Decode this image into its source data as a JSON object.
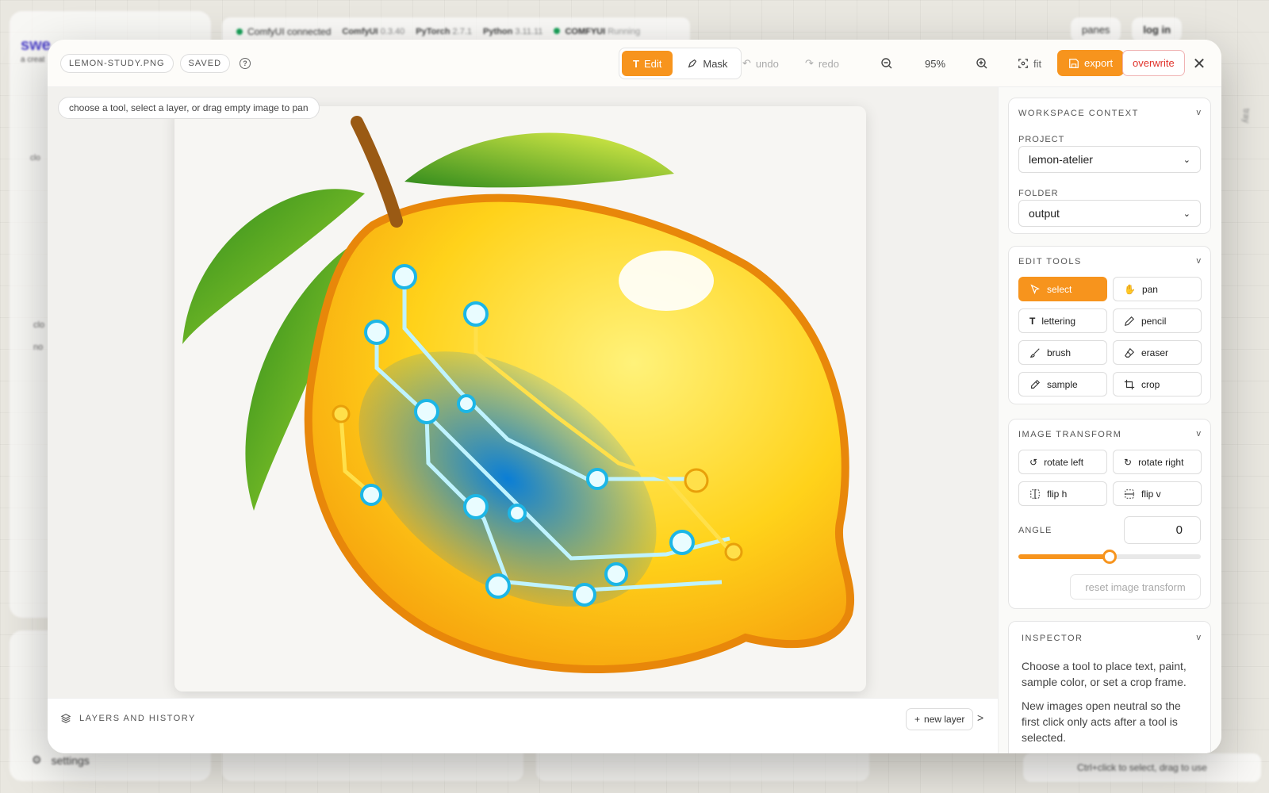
{
  "background": {
    "connection_status": "ComfyUI connected",
    "versions": [
      {
        "name": "ComfyUI",
        "value": "0.3.40"
      },
      {
        "name": "PyTorch",
        "value": "2.7.1"
      },
      {
        "name": "Python",
        "value": "3.11.11"
      }
    ],
    "server_name": "COMFYUI",
    "server_status": "Running",
    "brand": "swe",
    "brand_sub": "a creat",
    "panes_label": "panes",
    "login_label": "log in",
    "settings_label": "settings",
    "bottom_hint": "Ctrl+click to select, drag to use",
    "sidebar_labels": [
      "clo",
      "no"
    ],
    "tray_label": "tray"
  },
  "header": {
    "filename": "LEMON-STUDY.PNG",
    "save_status": "SAVED",
    "modes": [
      {
        "label": "Edit",
        "active": true
      },
      {
        "label": "Mask",
        "active": false
      }
    ],
    "undo_label": "undo",
    "redo_label": "redo",
    "zoom_level": "95%",
    "fit_label": "fit",
    "export_label": "export",
    "overwrite_label": "overwrite"
  },
  "canvas": {
    "hint": "choose a tool, select a layer, or drag empty image to pan"
  },
  "layers": {
    "title": "LAYERS AND HISTORY",
    "new_layer_label": "new layer",
    "expand_label": ">"
  },
  "sidebar": {
    "workspace": {
      "title": "WORKSPACE CONTEXT",
      "chevron": "v",
      "project_label": "PROJECT",
      "project_value": "lemon-atelier",
      "folder_label": "FOLDER",
      "folder_value": "output"
    },
    "edit_tools": {
      "title": "EDIT TOOLS",
      "chevron": "v",
      "tools": [
        {
          "label": "select",
          "icon": "cursor-icon",
          "active": true
        },
        {
          "label": "pan",
          "icon": "hand-icon",
          "active": false
        },
        {
          "label": "lettering",
          "icon": "text-icon",
          "active": false
        },
        {
          "label": "pencil",
          "icon": "pencil-icon",
          "active": false
        },
        {
          "label": "brush",
          "icon": "brush-icon",
          "active": false
        },
        {
          "label": "eraser",
          "icon": "eraser-icon",
          "active": false
        },
        {
          "label": "sample",
          "icon": "eyedropper-icon",
          "active": false
        },
        {
          "label": "crop",
          "icon": "crop-icon",
          "active": false
        }
      ]
    },
    "image_transform": {
      "title": "IMAGE TRANSFORM",
      "chevron": "v",
      "buttons": [
        {
          "label": "rotate left",
          "icon": "rotate-left-icon"
        },
        {
          "label": "rotate right",
          "icon": "rotate-right-icon"
        },
        {
          "label": "flip h",
          "icon": "flip-horizontal-icon"
        },
        {
          "label": "flip v",
          "icon": "flip-vertical-icon"
        }
      ],
      "angle_label": "ANGLE",
      "angle_value": "0",
      "angle_slider_fraction": 0.5,
      "reset_label": "reset image transform"
    },
    "inspector": {
      "title": "INSPECTOR",
      "chevron": "v",
      "paragraphs": [
        "Choose a tool to place text, paint, sample color, or set a crop frame.",
        "New images open neutral so the first click only acts after a tool is selected."
      ]
    }
  },
  "colors": {
    "accent": "#f7941d",
    "danger": "#e0332b",
    "connected": "#18a058"
  }
}
